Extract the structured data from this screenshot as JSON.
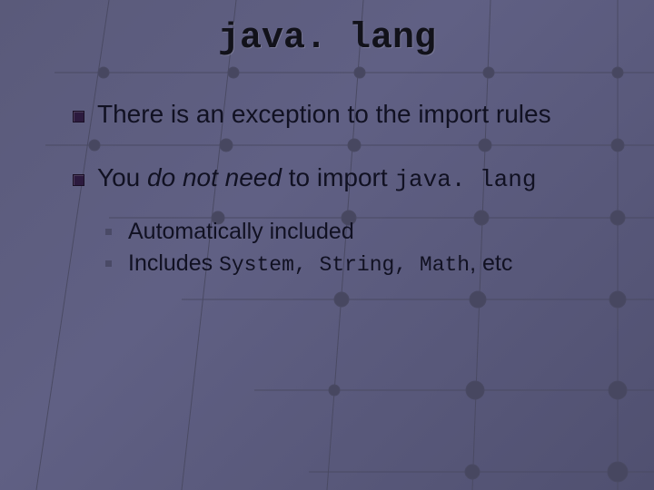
{
  "title": "java. lang",
  "bullets": [
    {
      "text": "There is an exception to the import rules"
    },
    {
      "prefix": "You ",
      "ital": "do not need",
      "mid": " to import ",
      "mono": "java. lang"
    }
  ],
  "sub": [
    {
      "text": "Automatically included"
    },
    {
      "prefix": "Includes ",
      "mono": "System, String, Math",
      "suffix": ", etc"
    }
  ]
}
